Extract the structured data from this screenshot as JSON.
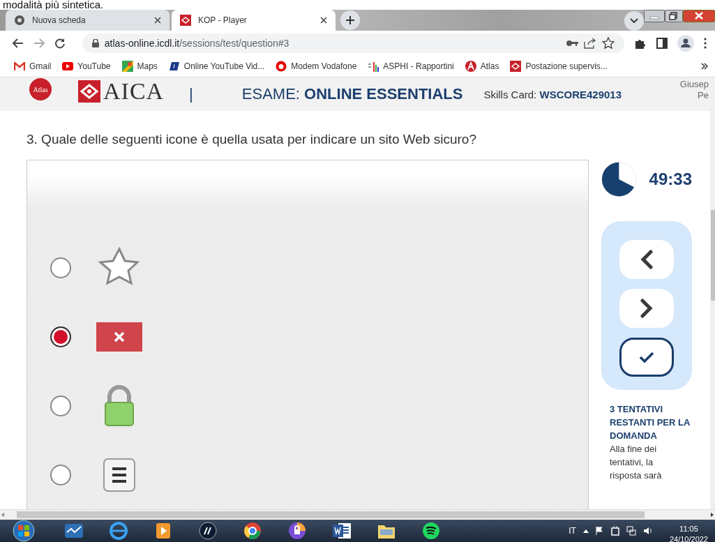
{
  "page_fragment": {
    "text": "modalità più sintetica."
  },
  "browser": {
    "tabs": [
      {
        "title": "Nuova scheda",
        "kind": "chrome",
        "selected": false
      },
      {
        "title": "KOP - Player",
        "kind": "aica",
        "selected": true
      }
    ],
    "address": {
      "host": "atlas-online.icdl.it",
      "path": "/sessions/test/question#3"
    },
    "bookmarks": [
      {
        "label": "Gmail",
        "kind": "gmail"
      },
      {
        "label": "YouTube",
        "kind": "youtube"
      },
      {
        "label": "Maps",
        "kind": "maps"
      },
      {
        "label": "Online YouTube Vid...",
        "kind": "video"
      },
      {
        "label": "Modem Vodafone",
        "kind": "vodafone"
      },
      {
        "label": "ASPHI - Rapportini",
        "kind": "chart"
      },
      {
        "label": "Atlas",
        "kind": "atlas"
      },
      {
        "label": "Postazione supervis...",
        "kind": "aica"
      }
    ]
  },
  "header": {
    "atlas_logo": "Atlas",
    "brand": "AICA",
    "separator": "|",
    "exam": "ESAME: **ONLINE ESSENTIALS**",
    "skills_card": "Skills Card: **WSCORE429013**",
    "user": [
      "Giusep",
      "Pe"
    ]
  },
  "question": "3. Quale delle seguenti icone è quella usata per indicare un sito Web sicuro?",
  "options": [
    {
      "kind": "star",
      "selected": false
    },
    {
      "kind": "error",
      "selected": true
    },
    {
      "kind": "padlock",
      "selected": false
    },
    {
      "kind": "menu",
      "selected": false
    }
  ],
  "timer": {
    "time": "49:33"
  },
  "attempts": {
    "title": "3 TENTATIVI RESTANTI PER LA DOMANDA",
    "note": "Alla fine dei tentativi, la risposta sarà"
  },
  "taskbar": {
    "language": "IT",
    "time": "11:05",
    "date": "24/10/2022"
  }
}
